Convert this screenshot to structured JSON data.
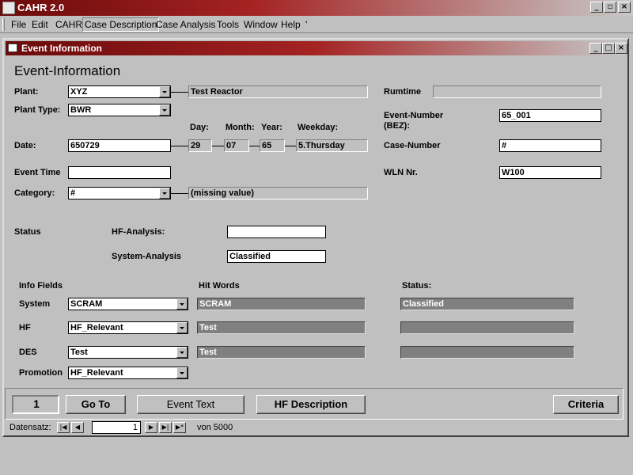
{
  "app": {
    "title": "CAHR 2.0"
  },
  "menu": [
    {
      "label": "File",
      "ul": "F"
    },
    {
      "label": "Edit",
      "ul": "E"
    },
    {
      "label": "CAHR",
      "ul": "C"
    },
    {
      "label": "Case Description",
      "ul": "D"
    },
    {
      "label": "Case Analysis",
      "ul": "A"
    },
    {
      "label": "Tools",
      "ul": "T"
    },
    {
      "label": "Window",
      "ul": "W"
    },
    {
      "label": "Help",
      "ul": "H"
    }
  ],
  "menu_extra": "'",
  "window": {
    "title": "Event Information"
  },
  "form": {
    "heading": "Event-Information",
    "plant_label": "Plant:",
    "plant_value": "XYZ",
    "plant_name": "Test Reactor",
    "plant_type_label": "Plant Type:",
    "plant_type_value": "BWR",
    "day_label": "Day:",
    "month_label": "Month:",
    "year_label": "Year:",
    "weekday_label": "Weekday:",
    "date_label": "Date:",
    "date_value": "650729",
    "day_value": "29",
    "month_value": "07",
    "year_value": "65",
    "weekday_value": "5.Thursday",
    "event_time_label": "Event Time",
    "event_time_value": "",
    "category_label": "Category:",
    "category_value": "#",
    "category_desc": "(missing value)",
    "rumtime_label": "Rumtime",
    "rumtime_value": "",
    "event_number_label": "Event-Number (BEZ):",
    "event_number_value": "65_001",
    "case_number_label": "Case-Number",
    "case_number_value": "#",
    "wln_label": "WLN Nr.",
    "wln_value": "W100",
    "status_label": "Status",
    "hf_analysis_label": "HF-Analysis:",
    "hf_analysis_value": "",
    "system_analysis_label": "System-Analysis",
    "system_analysis_value": "Classified",
    "info_fields_label": "Info Fields",
    "hit_words_label": "Hit Words",
    "status_col_label": "Status:",
    "rows": [
      {
        "label": "System",
        "value": "SCRAM",
        "hit": "SCRAM",
        "status": "Classified"
      },
      {
        "label": "HF",
        "value": "HF_Relevant",
        "hit": "Test",
        "status": ""
      },
      {
        "label": "DES",
        "value": "Test",
        "hit": "Test",
        "status": ""
      }
    ],
    "promotion_label": "Promotion",
    "promotion_value": "HF_Relevant"
  },
  "buttons": {
    "record_box": "1",
    "goto": "Go To",
    "event_text": "Event Text",
    "hf_description": "HF Description",
    "criteria": "Criteria"
  },
  "navigator": {
    "label": "Datensatz:",
    "current": "1",
    "total_text": "von 5000"
  }
}
